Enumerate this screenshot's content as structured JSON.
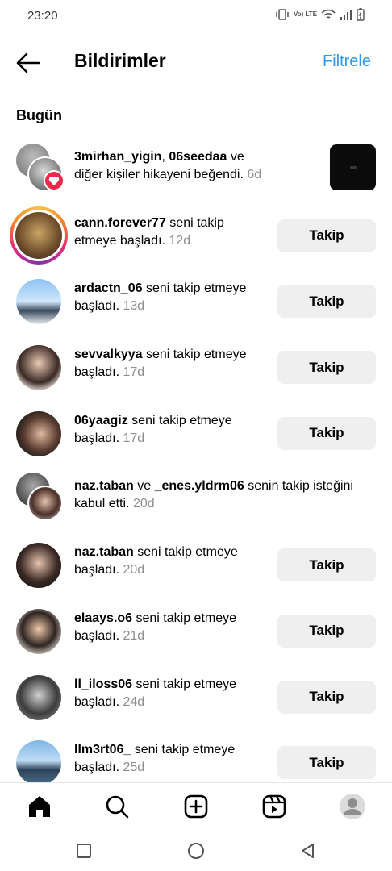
{
  "status_bar": {
    "time": "23:20",
    "network": "Vo) LTE"
  },
  "header": {
    "title": "Bildirimler",
    "filter_label": "Filtrele"
  },
  "section": {
    "title": "Bugün"
  },
  "notifications": [
    {
      "type": "like",
      "users": [
        "3mirhan_yigin",
        "06seedaa"
      ],
      "sep": ", ",
      "text": " ve diğer kişiler hikayeni beğendi. ",
      "time": "6d"
    },
    {
      "type": "follow",
      "user": "cann.forever77",
      "text": " seni takip etmeye başladı. ",
      "time": "12d",
      "button": "Takip"
    },
    {
      "type": "follow",
      "user": "ardactn_06",
      "text": " seni takip etmeye başladı. ",
      "time": "13d",
      "button": "Takip"
    },
    {
      "type": "follow",
      "user": "sevvalkyya",
      "text": " seni takip etmeye başladı. ",
      "time": "17d",
      "button": "Takip"
    },
    {
      "type": "follow",
      "user": "06yaagiz",
      "text": " seni takip etmeye başladı. ",
      "time": "17d",
      "button": "Takip"
    },
    {
      "type": "accept",
      "users": [
        "naz.taban",
        "_enes.yldrm06"
      ],
      "sep": " ve ",
      "text": " senin takip isteğini kabul etti. ",
      "time": "20d"
    },
    {
      "type": "follow",
      "user": "naz.taban",
      "text": " seni takip etmeye başladı. ",
      "time": "20d",
      "button": "Takip"
    },
    {
      "type": "follow",
      "user": "elaays.o6",
      "text": " seni takip etmeye başladı. ",
      "time": "21d",
      "button": "Takip"
    },
    {
      "type": "follow",
      "user": "ll_iloss06",
      "text": " seni takip etmeye başladı. ",
      "time": "24d",
      "button": "Takip"
    },
    {
      "type": "follow",
      "user": "llm3rt06_",
      "text": " seni takip etmeye başladı. ",
      "time": "25d",
      "button": "Takip"
    }
  ],
  "colors": {
    "accent": "#2f9bf0",
    "button_bg": "#efefef",
    "muted": "#8e8e8e",
    "heart": "#ed2a4a"
  },
  "bottom_nav": [
    "home-icon",
    "search-icon",
    "create-icon",
    "reels-icon",
    "profile-icon"
  ],
  "system_nav": [
    "recents-icon",
    "home-circle-icon",
    "back-triangle-icon"
  ]
}
